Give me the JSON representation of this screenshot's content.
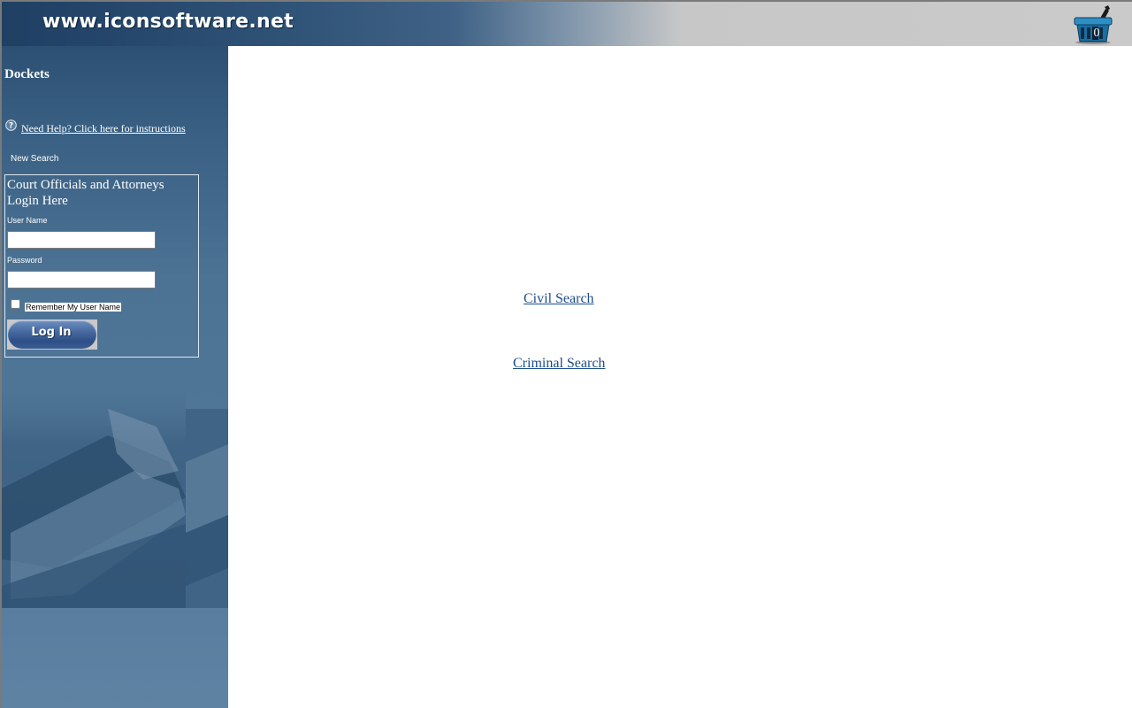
{
  "header": {
    "site_title": "www.iconsoftware.net",
    "cart_count": "0"
  },
  "sidebar": {
    "section_title": "Dockets",
    "help_link": "Need Help? Click here for instructions",
    "new_search": "New Search",
    "login": {
      "heading": "Court Officials and Attorneys Login Here",
      "username_label": "User Name",
      "username_value": "",
      "password_label": "Password",
      "password_value": "",
      "remember_label": "Remember My User Name",
      "remember_checked": false,
      "login_button": "Log In"
    }
  },
  "main": {
    "civil_search": "Civil Search",
    "criminal_search": "Criminal Search"
  },
  "colors": {
    "header_dark": "#1f3f63",
    "header_light": "#cacaca",
    "sidebar": "#4c7294",
    "link": "#1c4d8a"
  },
  "icons": {
    "cart": "shopping-basket-icon",
    "help": "question-circle-icon"
  }
}
